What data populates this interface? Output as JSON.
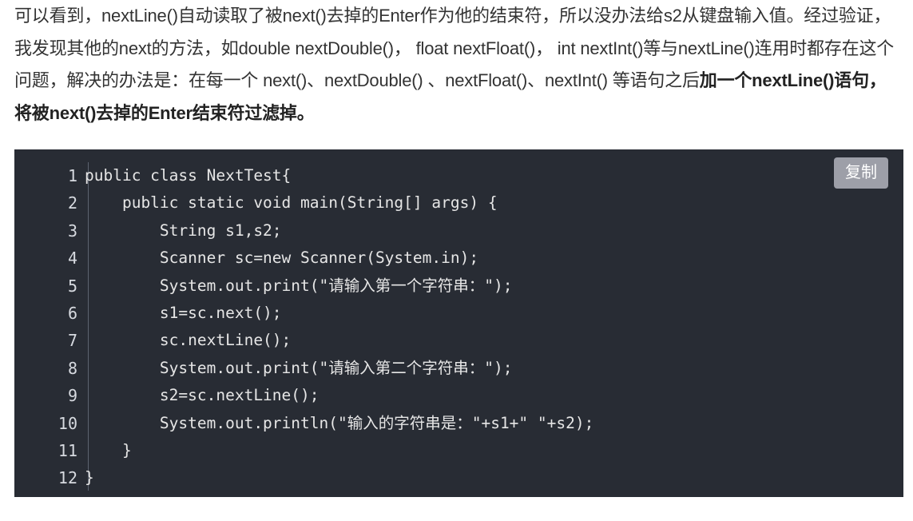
{
  "article": {
    "text_part1": "可以看到，nextLine()自动读取了被next()去掉的Enter作为他的结束符，所以没办法给s2从键盘输入值。经过验证，我发现其他的next的方法，如double nextDouble()， float nextFloat()， int nextInt()等与nextLine()连用时都存在这个问题，解决的办法是：在每一个 next()、nextDouble() 、nextFloat()、nextInt() 等语句之后",
    "text_bold": "加一个nextLine()语句，将被next()去掉的Enter结束符过滤掉。"
  },
  "code_block": {
    "copy_label": "复制",
    "lines": [
      {
        "number": "1",
        "code": "public class NextTest{"
      },
      {
        "number": "2",
        "code": "    public static void main(String[] args) {"
      },
      {
        "number": "3",
        "code": "        String s1,s2;"
      },
      {
        "number": "4",
        "code": "        Scanner sc=new Scanner(System.in);"
      },
      {
        "number": "5",
        "code": "        System.out.print(\"请输入第一个字符串：\");"
      },
      {
        "number": "6",
        "code": "        s1=sc.next();"
      },
      {
        "number": "7",
        "code": "        sc.nextLine();"
      },
      {
        "number": "8",
        "code": "        System.out.print(\"请输入第二个字符串：\");"
      },
      {
        "number": "9",
        "code": "        s2=sc.nextLine();"
      },
      {
        "number": "10",
        "code": "        System.out.println(\"输入的字符串是：\"+s1+\" \"+s2);"
      },
      {
        "number": "11",
        "code": "    }"
      },
      {
        "number": "12",
        "code": "}"
      }
    ]
  },
  "colors": {
    "code_background": "#282c34",
    "code_text": "#e6e6e6",
    "copy_button": "#9d9fa8"
  }
}
